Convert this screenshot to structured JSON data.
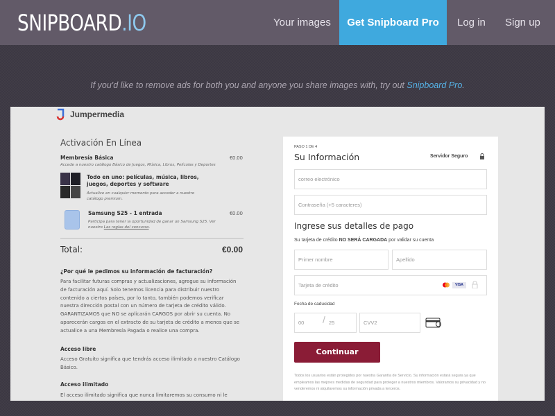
{
  "header": {
    "logo": {
      "main": "SNIPBOARD",
      "dot_io": ".IO"
    },
    "nav": {
      "your_images": "Your images",
      "get_pro": "Get Snipboard Pro",
      "log_in": "Log in",
      "sign_up": "Sign up"
    },
    "accent": "#3fa9de"
  },
  "promo": {
    "text": "If you'd like to remove ads for both you and anyone you share images with, try out ",
    "link": "Snipboard Pro",
    "end": "."
  },
  "screenshot": {
    "brand": "Jumpermedia",
    "left": {
      "title": "Activación En Línea",
      "membership": {
        "title": "Membresía Básica",
        "price": "€0.00",
        "desc": "Accede a nuestro catálogo Básico de Juegos, Música, Libros, Películas y Deportes"
      },
      "all_in_one": {
        "title": "Todo en uno: películas, música, libros, juegos, deportes y software",
        "desc": "Actualice en cualquier momento para acceder a nuestro catálogo premium."
      },
      "samsung": {
        "title": "Samsung S25 - 1 entrada",
        "price": "€0.00",
        "desc": "Participa para tener la oportunidad de ganar un Samsung S25. Ver nuestro ",
        "link": "Las reglas del concurso",
        "end": "."
      },
      "total_label": "Total:",
      "total_value": "€0.00",
      "why_title": "¿Por qué le pedimos su información de facturación?",
      "why_text": "Para facilitar futuras compras y actualizaciones, agregue su información de facturación aquí. Solo tenemos licencia para distribuir nuestro contenido a ciertos países, por lo tanto, también podemos verificar nuestra dirección postal con un número de tarjeta de crédito válido. GARANTIZAMOS que NO se aplicarán CARGOS por abrir su cuenta. No aparecerán cargos en el extracto de su tarjeta de crédito a menos que se actualice a una Membresía Pagada o realice una compra.",
      "free_title": "Acceso libre",
      "free_text": "Acceso Gratuito significa que tendrás acceso ilimitado a nuestro Catálogo Básico.",
      "unlimited_title": "Acceso ilimitado",
      "unlimited_text": "El acceso ilimitado significa que nunca limitaremos su consumo ni le"
    },
    "form": {
      "step": "PASO 1 DE 4",
      "title": "Su Información",
      "secure": "Servidor Seguro",
      "email_placeholder": "correo electrónico",
      "password_placeholder": "Contraseña (+5 caracteres)",
      "payment_title": "Ingrese sus detalles de pago",
      "note_pre": "Su tarjeta de crédito ",
      "note_bold": "NO SERÁ CARGADA",
      "note_post": " por validar su cuenta",
      "first_name": "Primer nombre",
      "last_name": "Apellido",
      "card_placeholder": "Tarjeta de crédito",
      "visa": "VISA",
      "expiry_label": "Fecha de caducidad",
      "month": "00",
      "year": "25",
      "cvv": "CVV2",
      "button": "Continuar",
      "button_color": "#8a1c36",
      "fine_print": "Todos los usuarios están protegidos por nuestra Garantía de Servicio. Su información estará segura ya que empleamos las mejores medidas de seguridad para proteger a nuestros miembros. Valoramos su privacidad y no venderemos ni alquilaremos su información privada a terceros."
    }
  }
}
